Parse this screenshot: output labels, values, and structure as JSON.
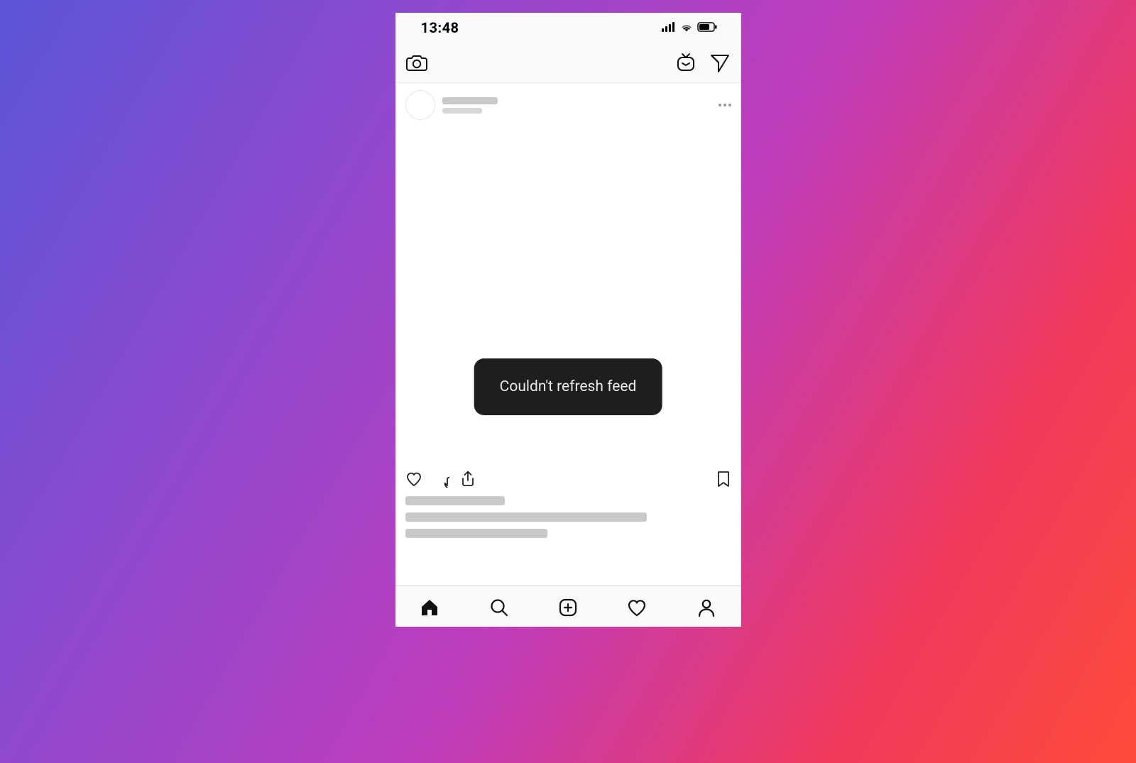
{
  "statusbar": {
    "time": "13:48",
    "icons": {
      "signal": "cellular-signal",
      "wifi": "wifi",
      "battery": "battery"
    }
  },
  "topbar": {
    "camera": "camera-icon",
    "igtv": "igtv-icon",
    "messages": "send-icon"
  },
  "post": {
    "more": "more-options",
    "actions": {
      "like": "heart-icon",
      "comment": "speech-bubble-icon",
      "share": "share-icon",
      "save": "bookmark-icon"
    }
  },
  "toast": {
    "message": "Couldn't refresh feed"
  },
  "bottomnav": {
    "home": "home-icon",
    "search": "search-icon",
    "add": "add-post-icon",
    "activity": "heart-icon",
    "profile": "profile-icon",
    "active": "home"
  }
}
